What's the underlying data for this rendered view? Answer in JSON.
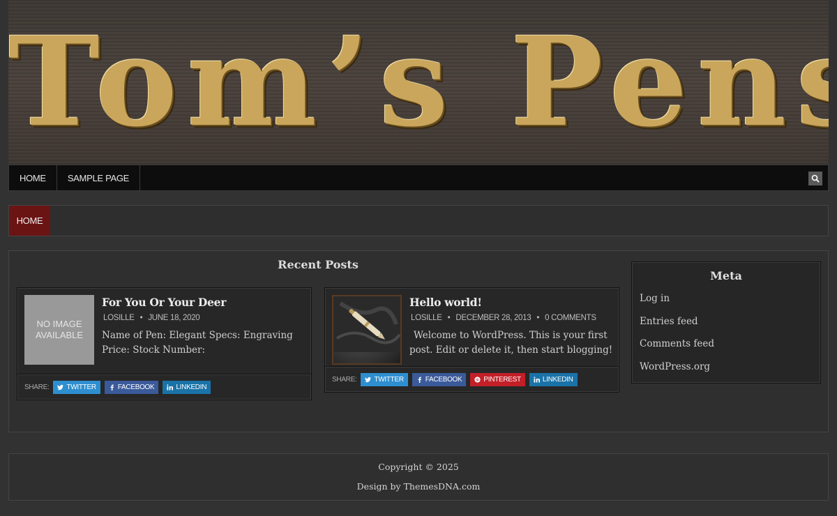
{
  "site": {
    "title": "Tom’s Pens"
  },
  "primary_nav": {
    "items": [
      {
        "label": "HOME"
      },
      {
        "label": "SAMPLE PAGE"
      }
    ],
    "search_icon": "search-icon"
  },
  "secondary_nav": {
    "items": [
      {
        "label": "HOME"
      }
    ]
  },
  "recent_posts": {
    "heading": "Recent Posts",
    "posts": [
      {
        "thumbnail_text": "NO IMAGE AVAILABLE",
        "title": "For You Or Your Deer",
        "author": "LOSILLE",
        "date": "JUNE 18, 2020",
        "comments": "",
        "excerpt": "Name of Pen: Elegant Specs: Engraving Price: Stock Number:",
        "share_label": "SHARE:",
        "share_buttons": [
          "TWITTER",
          "FACEBOOK",
          "LINKEDIN"
        ]
      },
      {
        "thumbnail_text": "",
        "title": "Hello world!",
        "author": "LOSILLE",
        "date": "DECEMBER 28, 2013",
        "comments": "0 COMMENTS",
        "excerpt": "Welcome to WordPress. This is your first post. Edit or delete it, then start blogging!",
        "share_label": "SHARE:",
        "share_buttons": [
          "TWITTER",
          "FACEBOOK",
          "PINTEREST",
          "LINKEDIN"
        ]
      }
    ]
  },
  "meta_widget": {
    "title": "Meta",
    "links": [
      "Log in",
      "Entries feed",
      "Comments feed",
      "WordPress.org"
    ]
  },
  "footer": {
    "copyright": "Copyright © 2025",
    "credit": "Design by ThemesDNA.com"
  },
  "colors": {
    "page_bg": "#323232",
    "nav_bg": "#0d0d0d",
    "active_menu": "#6b1414",
    "title_gold": "#c9a65b",
    "twitter": "#2e8fd0",
    "facebook": "#3b5a9a",
    "pinterest": "#c21f28",
    "linkedin": "#1a73a8"
  }
}
